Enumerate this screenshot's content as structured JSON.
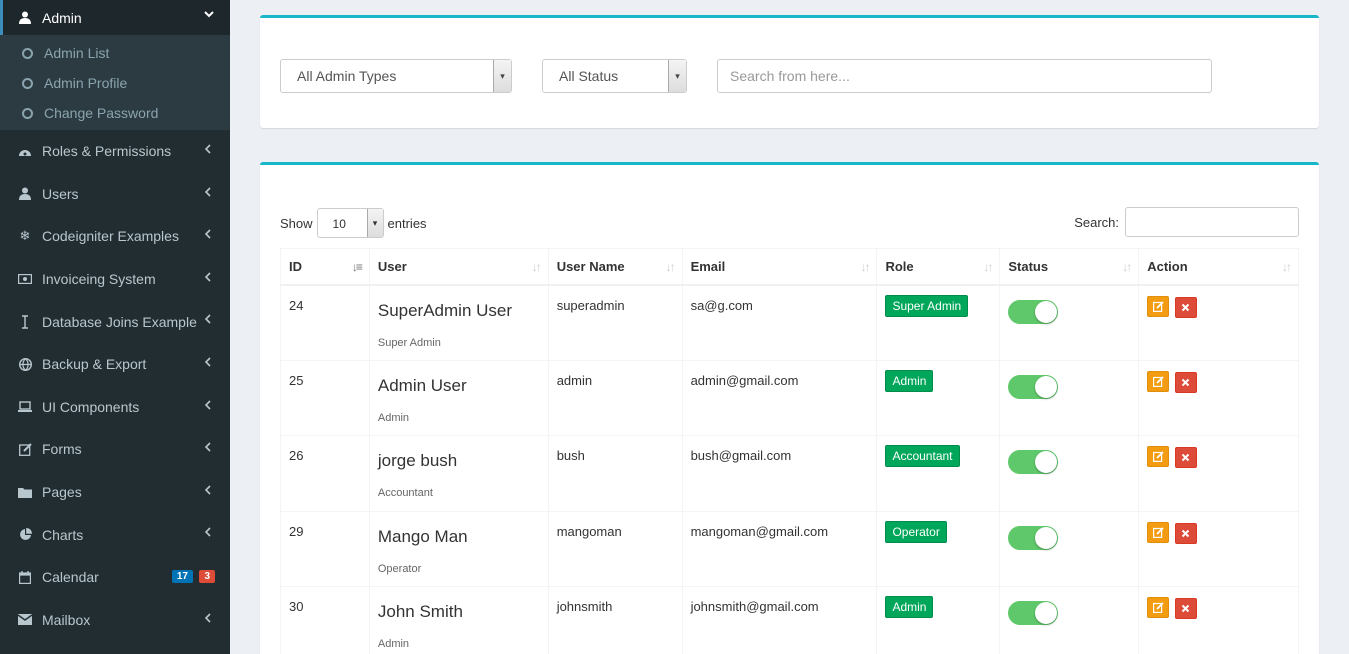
{
  "sidebar": {
    "active": {
      "label": "Admin",
      "icon": "user-icon"
    },
    "submenu": [
      {
        "label": "Admin List"
      },
      {
        "label": "Admin Profile"
      },
      {
        "label": "Change Password"
      }
    ],
    "items": [
      {
        "label": "Roles & Permissions",
        "icon": "dashboard-icon"
      },
      {
        "label": "Users",
        "icon": "user-icon"
      },
      {
        "label": "Codeigniter Examples",
        "icon": "snowflake-icon"
      },
      {
        "label": "Invoiceing System",
        "icon": "money-icon"
      },
      {
        "label": "Database Joins Example",
        "icon": "i-cursor-icon"
      },
      {
        "label": "Backup & Export",
        "icon": "globe-icon"
      },
      {
        "label": "UI Components",
        "icon": "laptop-icon"
      },
      {
        "label": "Forms",
        "icon": "edit-icon"
      },
      {
        "label": "Pages",
        "icon": "folder-icon"
      },
      {
        "label": "Charts",
        "icon": "pie-chart-icon"
      },
      {
        "label": "Calendar",
        "icon": "calendar-icon",
        "badges": [
          "17",
          "3"
        ]
      },
      {
        "label": "Mailbox",
        "icon": "envelope-icon"
      }
    ]
  },
  "filters": {
    "admin_type": "All Admin Types",
    "status": "All Status",
    "search_placeholder": "Search from here..."
  },
  "table_controls": {
    "show_label": "Show",
    "entries_value": "10",
    "entries_label": "entries",
    "search_label": "Search:"
  },
  "table": {
    "headers": [
      "ID",
      "User",
      "User Name",
      "Email",
      "Role",
      "Status",
      "Action"
    ],
    "rows": [
      {
        "id": "24",
        "name": "SuperAdmin User",
        "role_sub": "Super Admin",
        "username": "superadmin",
        "email": "sa@g.com",
        "role": "Super Admin"
      },
      {
        "id": "25",
        "name": "Admin User",
        "role_sub": "Admin",
        "username": "admin",
        "email": "admin@gmail.com",
        "role": "Admin"
      },
      {
        "id": "26",
        "name": "jorge bush",
        "role_sub": "Accountant",
        "username": "bush",
        "email": "bush@gmail.com",
        "role": "Accountant"
      },
      {
        "id": "29",
        "name": "Mango Man",
        "role_sub": "Operator",
        "username": "mangoman",
        "email": "mangoman@gmail.com",
        "role": "Operator"
      },
      {
        "id": "30",
        "name": "John Smith",
        "role_sub": "Admin",
        "username": "johnsmith",
        "email": "johnsmith@gmail.com",
        "role": "Admin"
      }
    ]
  },
  "colors": {
    "sidebar_bg": "#222d32",
    "box_top_border": "#17b6c9",
    "role_badge": "#00a65a",
    "toggle_on": "#5fc86a",
    "edit_button": "#f39c12",
    "delete_button": "#dd4b39"
  }
}
